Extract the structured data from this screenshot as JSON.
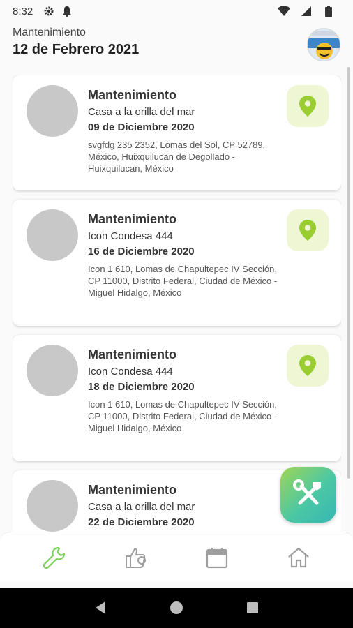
{
  "status_bar": {
    "time": "8:32",
    "icons": [
      "gear-icon",
      "bell-icon",
      "wifi-icon",
      "signal-icon",
      "battery-icon"
    ]
  },
  "header": {
    "subtitle": "Mantenimiento",
    "title": "12 de Febrero 2021"
  },
  "cards": [
    {
      "type": "Mantenimiento",
      "place": "Casa a la orilla del mar",
      "date": "09 de Diciembre 2020",
      "address": "svgfdg 235 2352, Lomas del Sol, CP 52789, México, Huixquilucan de Degollado - Huixquilucan, México"
    },
    {
      "type": "Mantenimiento",
      "place": "Icon Condesa 444",
      "date": "16 de Diciembre 2020",
      "address": "Icon 1 610, Lomas de Chapultepec IV Sección, CP 11000, Distrito Federal, Ciudad de México - Miguel Hidalgo, México"
    },
    {
      "type": "Mantenimiento",
      "place": "Icon Condesa 444",
      "date": "18 de Diciembre 2020",
      "address": "Icon 1 610, Lomas de Chapultepec IV Sección, CP 11000, Distrito Federal, Ciudad de México - Miguel Hidalgo, México"
    },
    {
      "type": "Mantenimiento",
      "place": "Casa a la orilla del mar",
      "date": "22 de Diciembre 2020",
      "address": ""
    }
  ],
  "bottom_nav": {
    "items": [
      "wrench-icon",
      "thumbs-up-icon",
      "calendar-icon",
      "home-icon"
    ],
    "active_color": "#7ccf5a",
    "inactive_color": "#9e9e9e"
  },
  "fab": {
    "icon": "tools-icon"
  },
  "colors": {
    "accent_green": "#9fd655",
    "accent_teal": "#37b8b4",
    "pin_bg": "#eef6d4",
    "pin_icon": "#9acd32"
  }
}
